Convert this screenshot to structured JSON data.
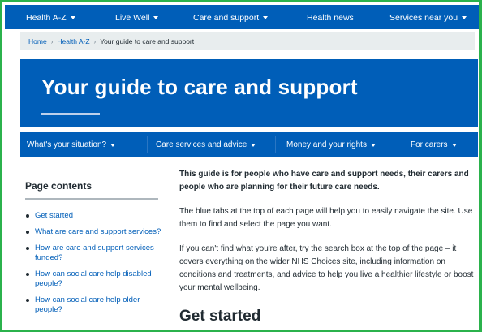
{
  "topnav": {
    "items": [
      {
        "label": "Health A-Z"
      },
      {
        "label": "Live Well"
      },
      {
        "label": "Care and support"
      },
      {
        "label": "Health news"
      },
      {
        "label": "Services near you"
      }
    ]
  },
  "breadcrumb": {
    "home": "Home",
    "health_az": "Health A-Z",
    "separator": "›",
    "current": "Your guide to care and support"
  },
  "hero": {
    "title": "Your guide to care and support"
  },
  "tabs": {
    "items": [
      {
        "label": "What's your situation?"
      },
      {
        "label": "Care services and advice"
      },
      {
        "label": "Money and your rights"
      },
      {
        "label": "For carers"
      }
    ]
  },
  "sidebar": {
    "title": "Page contents",
    "items": [
      {
        "label": "Get started"
      },
      {
        "label": "What are care and support services?"
      },
      {
        "label": "How are care and support services funded?"
      },
      {
        "label": "How can social care help disabled people?"
      },
      {
        "label": "How can social care help older people?"
      }
    ]
  },
  "main": {
    "intro": "This guide is for people who have care and support needs, their carers and people who are planning for their future care needs.",
    "para1": "The blue tabs at the top of each page will help you to easily navigate the site. Use them to find and select the page you want.",
    "para2": "If you can't find what you're after, try the search box at the top of the page – it covers everything on the wider NHS Choices site, including information on conditions and treatments, and advice to help you live a healthier lifestyle or boost your mental wellbeing.",
    "heading": "Get started"
  },
  "colors": {
    "nhs_blue": "#005eb8",
    "breadcrumb_bg": "#e8edee",
    "frame_green": "#2bb24c"
  }
}
